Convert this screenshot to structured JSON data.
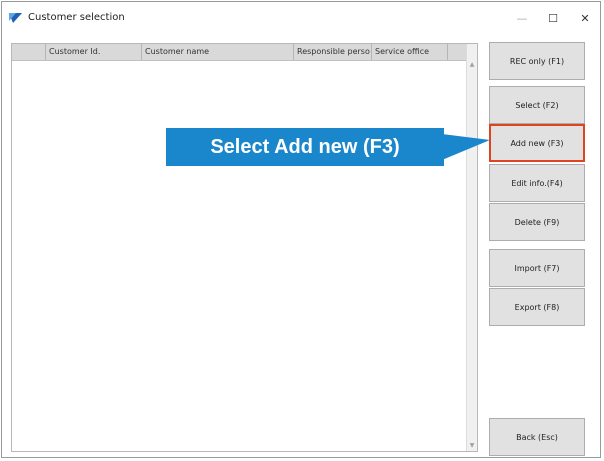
{
  "window": {
    "title": "Customer selection",
    "controls": {
      "minimize": "—",
      "maximize": "☐",
      "close": "✕"
    }
  },
  "grid": {
    "columns": [
      "",
      "Customer Id.",
      "Customer name",
      "Responsible perso",
      "Service office"
    ],
    "rows": []
  },
  "buttons": [
    {
      "label": "REC only (F1)"
    },
    {
      "label": "Select (F2)"
    },
    {
      "label": "Add new (F3)"
    },
    {
      "label": "Edit info.(F4)"
    },
    {
      "label": "Delete (F9)"
    },
    {
      "label": "Import (F7)"
    },
    {
      "label": "Export (F8)"
    },
    {
      "label": "Back (Esc)"
    }
  ],
  "callout": {
    "text": "Select Add new (F3)",
    "color": "#1a86cc",
    "highlight_color": "#e0441f"
  },
  "icons": {
    "app": "app-logo-icon"
  }
}
